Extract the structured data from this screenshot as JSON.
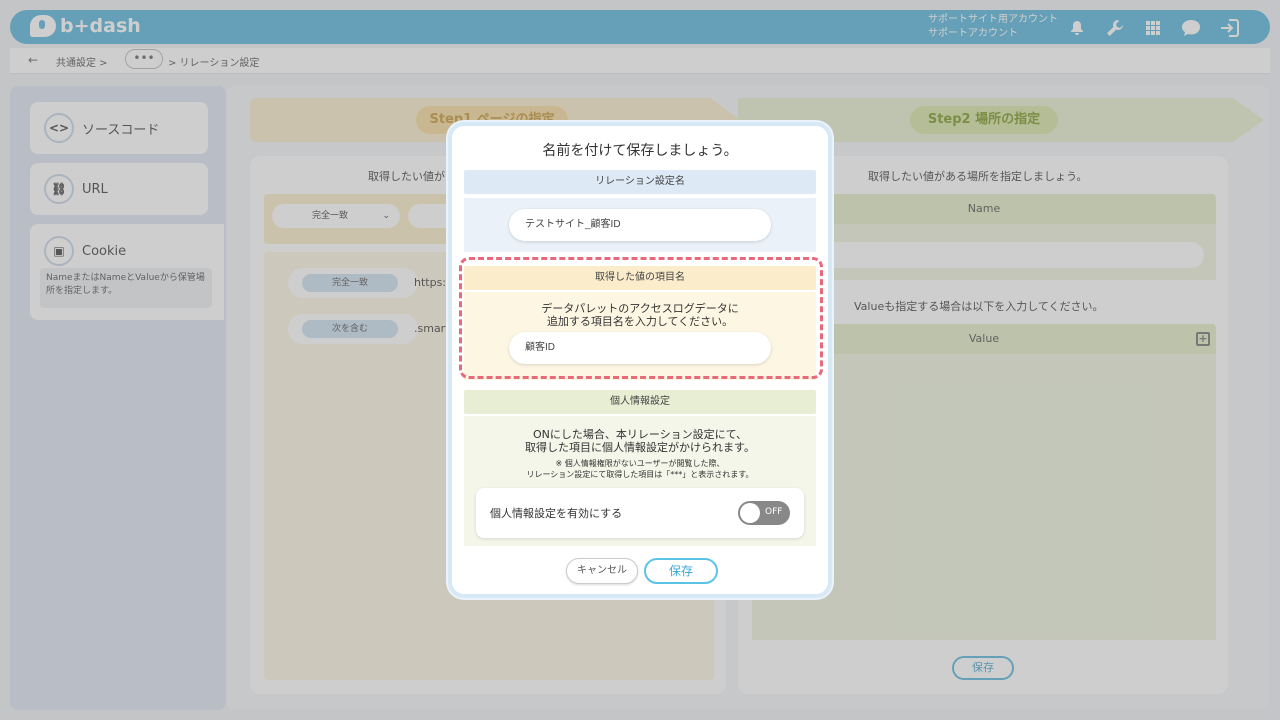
{
  "header": {
    "logo": "b+dash",
    "account_line1": "サポートサイト用アカウント",
    "account_line2": "サポートアカウント",
    "icons": [
      "bell-icon",
      "wrench-icon",
      "grid-icon",
      "chat-icon",
      "logout-icon"
    ]
  },
  "breadcrumb": {
    "back": "←",
    "item1": "共通設定 >",
    "dots": "•••",
    "item2": "> リレーション設定"
  },
  "sidebar": {
    "items": [
      {
        "icon": "<>",
        "label": "ソースコード"
      },
      {
        "icon": "⛓",
        "label": "URL"
      },
      {
        "icon": "▣",
        "label": "Cookie"
      }
    ],
    "cookie_note": "NameまたはNameとValueから保管場所を指定します。"
  },
  "steps": {
    "step1": "Step1 ページの指定",
    "step2": "Step2 場所の指定"
  },
  "panel1": {
    "hint": "取得したい値が",
    "select_value": "完全一致",
    "rows": [
      {
        "tag": "完全一致",
        "text": "https:/"
      },
      {
        "tag": "次を含む",
        "text": ".smart"
      }
    ]
  },
  "panel2": {
    "hint": "取得したい値がある場所を指定しましょう。",
    "name_header": "Name",
    "hint2": "Valueも指定する場合は以下を入力してください。",
    "value_header": "Value",
    "save": "保存"
  },
  "modal": {
    "title": "名前を付けて保存しましょう。",
    "sec1_header": "リレーション設定名",
    "sec1_value": "テストサイト_顧客ID",
    "sec2_header": "取得した値の項目名",
    "sec2_desc1": "データパレットのアクセスログデータに",
    "sec2_desc2": "追加する項目名を入力してください。",
    "sec2_value": "顧客ID",
    "sec3_header": "個人情報設定",
    "sec3_desc1": "ONにした場合、本リレーション設定にて、",
    "sec3_desc2": "取得した項目に個人情報設定がかけられます。",
    "sec3_note1": "※ 個人情報権限がないユーザーが閲覧した際、",
    "sec3_note2": "リレーション設定にて取得した項目は「***」と表示されます。",
    "toggle_label": "個人情報設定を有効にする",
    "toggle_state": "OFF",
    "cancel": "キャンセル",
    "save": "保存"
  },
  "colors": {
    "header_bg": "#5bb8dd",
    "highlight_border": "#e86a7a",
    "save_accent": "#5bc3e6"
  }
}
